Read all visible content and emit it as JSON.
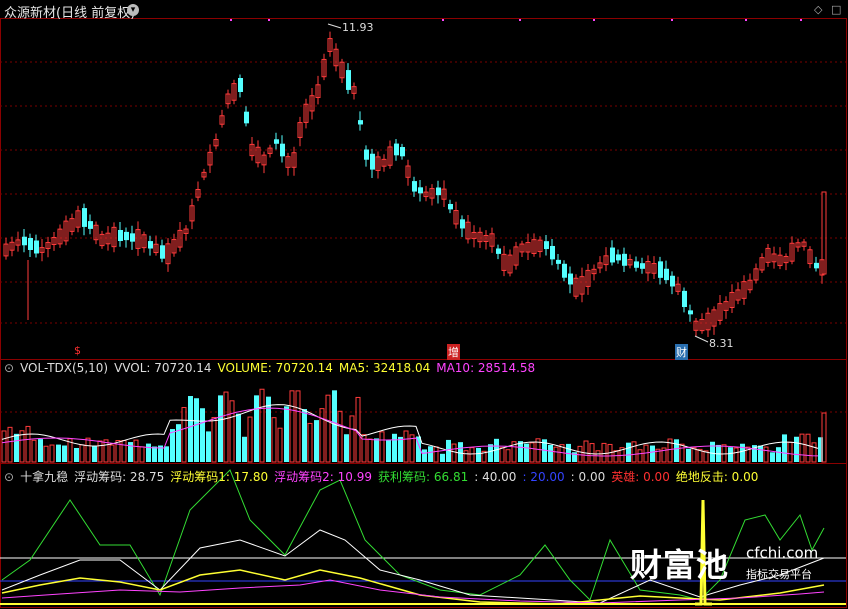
{
  "window": {
    "title": "众源新材(日线 前复权)",
    "btn_glyph": "▾",
    "ctrl_left": "◇",
    "ctrl_right": "□"
  },
  "price_panel": {
    "high_label": "11.93",
    "low_label": "8.31",
    "signals": [
      {
        "text": "$",
        "color": "#ff3030"
      },
      {
        "text": "增",
        "color": "#ffffff",
        "bg": "#cc2222"
      },
      {
        "text": "财",
        "color": "#ffffff",
        "bg": "#2a6fb0"
      }
    ]
  },
  "vol_header": {
    "name": "VOL-TDX(5,10)",
    "vvol": "VVOL: 70720.14",
    "volume": "VOLUME: 70720.14",
    "ma5": "MA5: 32418.04",
    "ma10": "MA10: 28514.58"
  },
  "ind_header": {
    "name": "十拿九稳",
    "f1": "浮动筹码: 28.75",
    "f2": "浮动筹码1: 17.80",
    "f3": "浮动筹码2: 10.99",
    "f4": "获利筹码: 66.81",
    "f5": ": 40.00",
    "f6": ": 20.00",
    "f7": ": 0.00",
    "f8": "英雄: 0.00",
    "f9": "绝地反击: 0.00"
  },
  "colors": {
    "up": "#ff3b3b",
    "down": "#54ffff",
    "ma5": "#ffffff",
    "ma10": "#ff44ff",
    "grid": "#7a0000",
    "green": "#33dd33",
    "yellow": "#ffff33",
    "blue": "#3344ff",
    "magenta": "#ff44ff",
    "white": "#ffffff"
  },
  "watermark": {
    "big": "财富池",
    "url": "cfchi.com",
    "sub": "指标交易平台"
  }
}
